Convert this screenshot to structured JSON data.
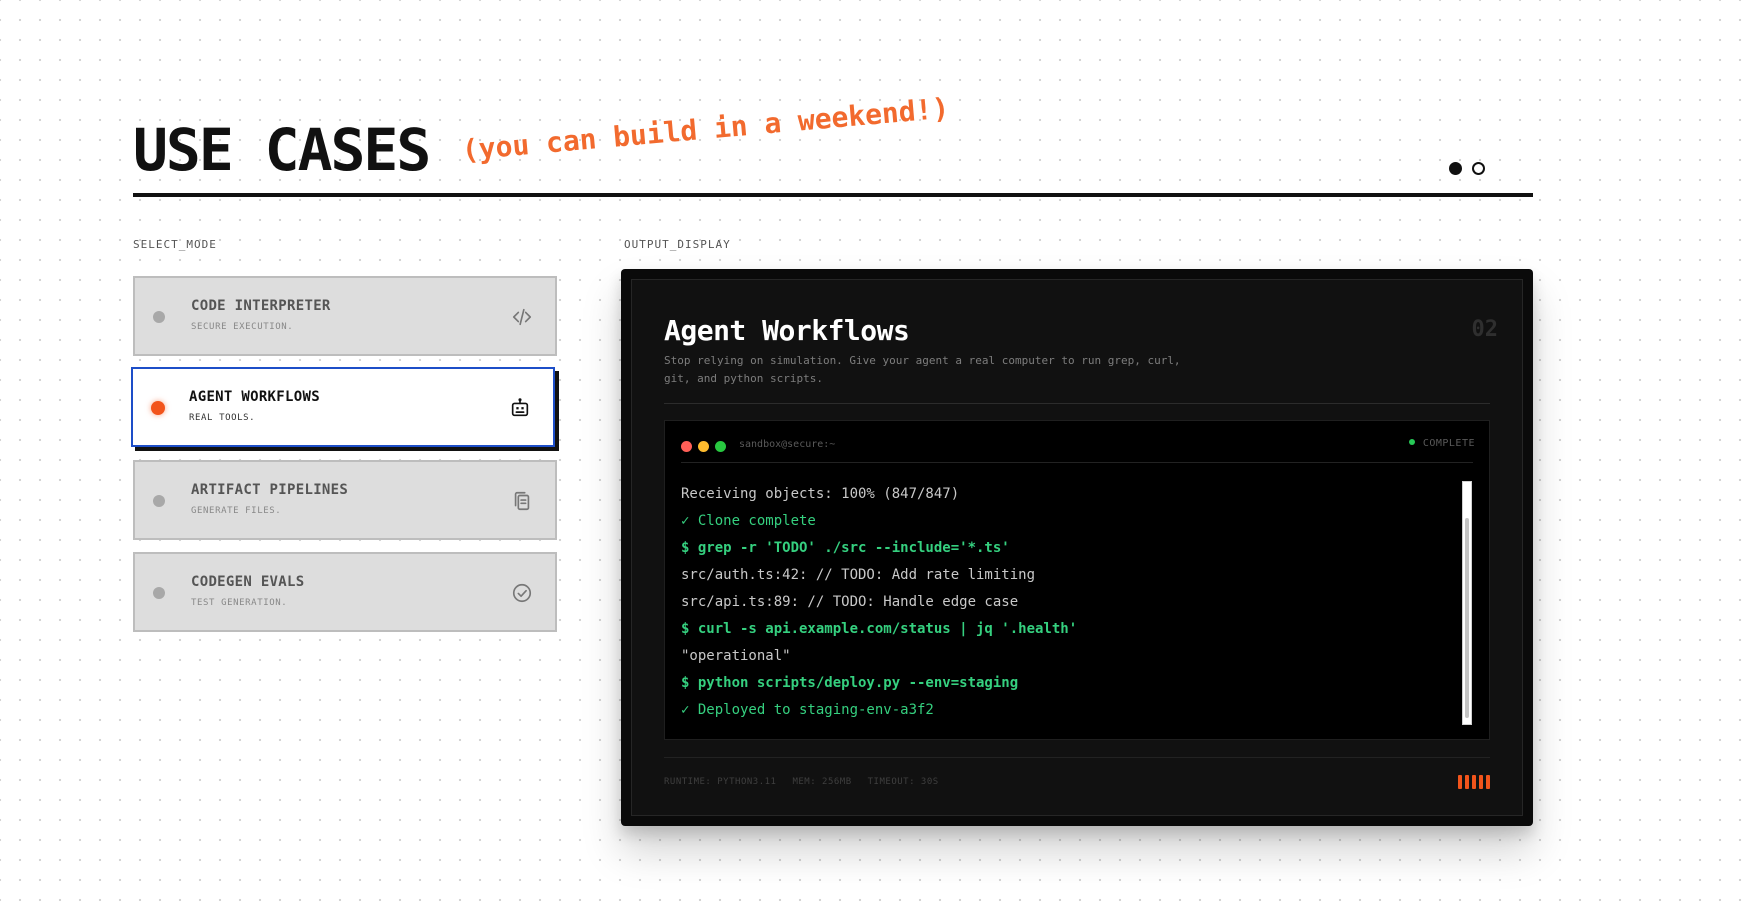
{
  "header": {
    "title": "USE CASES",
    "subtitle": "(you can build in a weekend!)",
    "pager": {
      "total": 2,
      "active": 1
    }
  },
  "select_mode": {
    "label": "SELECT_MODE",
    "modes": [
      {
        "title": "CODE INTERPRETER",
        "subtitle": "SECURE EXECUTION.",
        "icon": "code-icon",
        "active": false
      },
      {
        "title": "AGENT WORKFLOWS",
        "subtitle": "REAL TOOLS.",
        "icon": "robot-icon",
        "active": true
      },
      {
        "title": "ARTIFACT PIPELINES",
        "subtitle": "GENERATE FILES.",
        "icon": "files-icon",
        "active": false
      },
      {
        "title": "CODEGEN EVALS",
        "subtitle": "TEST GENERATION.",
        "icon": "check-circle-icon",
        "active": false
      }
    ]
  },
  "output_display": {
    "label": "OUTPUT_DISPLAY",
    "title": "Agent Workflows",
    "number": "02",
    "description": "Stop relying on simulation. Give your agent a real computer to run grep, curl, git, and python scripts.",
    "terminal": {
      "host": "sandbox@secure:~",
      "status": "COMPLETE",
      "lines": [
        {
          "text": "Receiving objects: 100% (847/847)",
          "kind": "output"
        },
        {
          "text": "✓ Clone complete",
          "kind": "ok"
        },
        {
          "text": "$ grep -r 'TODO' ./src --include='*.ts'",
          "kind": "cmd"
        },
        {
          "text": "src/auth.ts:42: // TODO: Add rate limiting",
          "kind": "output"
        },
        {
          "text": "src/api.ts:89: // TODO: Handle edge case",
          "kind": "output"
        },
        {
          "text": "$ curl -s api.example.com/status | jq '.health'",
          "kind": "cmd"
        },
        {
          "text": "\"operational\"",
          "kind": "output"
        },
        {
          "text": "$ python scripts/deploy.py --env=staging",
          "kind": "cmd"
        },
        {
          "text": "✓ Deployed to staging-env-a3f2",
          "kind": "ok"
        }
      ]
    },
    "footer": {
      "runtime": "RUNTIME: PYTHON3.11",
      "memory": "MEM: 256MB",
      "timeout": "TIMEOUT: 30S"
    }
  },
  "colors": {
    "accent": "#f26a2e",
    "active_border": "#1d4ec8",
    "terminal_green": "#35d07f",
    "traffic_red": "#ff5f57",
    "traffic_yellow": "#febc2e",
    "traffic_green": "#28c840"
  }
}
